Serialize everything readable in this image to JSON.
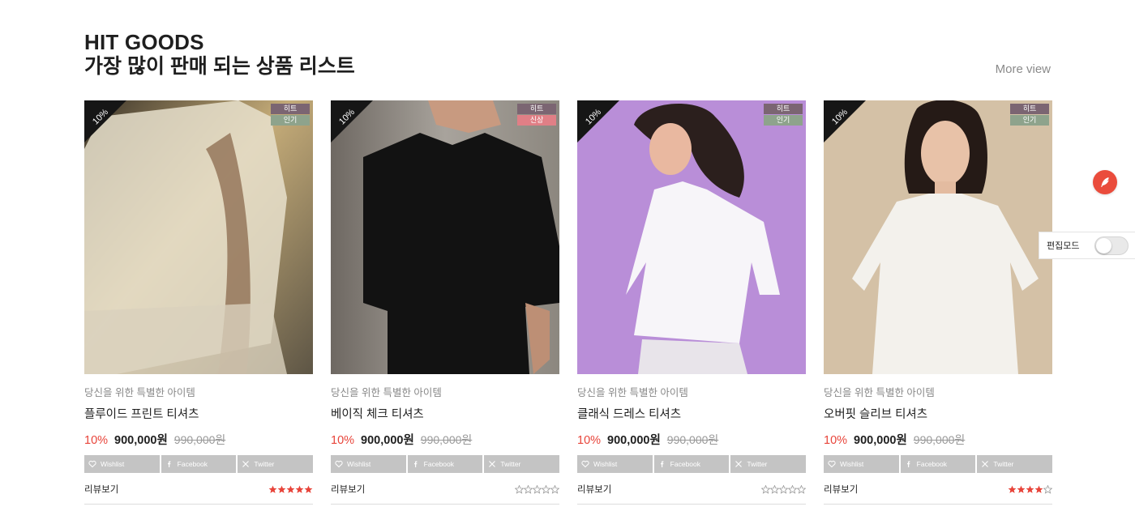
{
  "section": {
    "title_en": "HIT GOODS",
    "title_ko": "가장 많이 판매 되는 상품 리스트",
    "more_label": "More view"
  },
  "products": [
    {
      "discount_tag": "10%",
      "badges": [
        {
          "label": "히트",
          "color": "#7b6572"
        },
        {
          "label": "인기",
          "color": "#8ea38c"
        }
      ],
      "subtitle": "당신을 위한 특별한 아이템",
      "name": "플루이드 프린트 티셔츠",
      "rate": "10%",
      "price": "900,000원",
      "old_price": "990,000원",
      "shares": [
        "Wishlist",
        "Facebook",
        "Twitter"
      ],
      "review_label": "리뷰보기",
      "rating": 5
    },
    {
      "discount_tag": "10%",
      "badges": [
        {
          "label": "히트",
          "color": "#7b6572"
        },
        {
          "label": "신상",
          "color": "#e07f86"
        }
      ],
      "subtitle": "당신을 위한 특별한 아이템",
      "name": "베이직 체크 티셔츠",
      "rate": "10%",
      "price": "900,000원",
      "old_price": "990,000원",
      "shares": [
        "Wishlist",
        "Facebook",
        "Twitter"
      ],
      "review_label": "리뷰보기",
      "rating": 0
    },
    {
      "discount_tag": "10%",
      "badges": [
        {
          "label": "히트",
          "color": "#7b6572"
        },
        {
          "label": "인기",
          "color": "#8ea38c"
        }
      ],
      "subtitle": "당신을 위한 특별한 아이템",
      "name": "클래식 드레스 티셔츠",
      "rate": "10%",
      "price": "900,000원",
      "old_price": "990,000원",
      "shares": [
        "Wishlist",
        "Facebook",
        "Twitter"
      ],
      "review_label": "리뷰보기",
      "rating": 0
    },
    {
      "discount_tag": "10%",
      "badges": [
        {
          "label": "히트",
          "color": "#7b6572"
        },
        {
          "label": "인기",
          "color": "#8ea38c"
        }
      ],
      "subtitle": "당신을 위한 특별한 아이템",
      "name": "오버핏 슬리브 티셔츠",
      "rate": "10%",
      "price": "900,000원",
      "old_price": "990,000원",
      "shares": [
        "Wishlist",
        "Facebook",
        "Twitter"
      ],
      "review_label": "리뷰보기",
      "rating": 4
    }
  ],
  "share_icons": [
    "heart-icon",
    "facebook-icon",
    "x-twitter-icon"
  ],
  "colors": {
    "accent": "#e8443a",
    "star": "#e8443a",
    "star_empty": "#999999",
    "share_bg": "#c4c4c4",
    "fab": "#ea4c3c"
  },
  "side": {
    "fab_icon": "feather-pen-icon",
    "edit_mode_label": "편집모드",
    "edit_mode_on": false
  }
}
